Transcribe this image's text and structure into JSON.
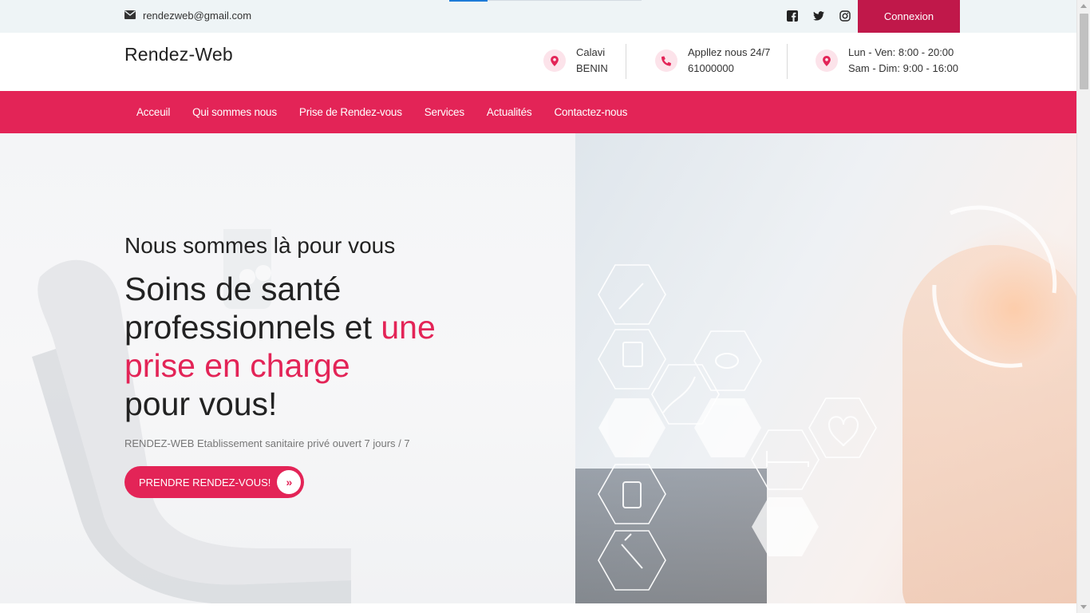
{
  "topbar": {
    "email": "rendezweb@gmail.com",
    "email_icon": "envelope-icon",
    "social_icons": [
      "facebook-icon",
      "twitter-icon",
      "instagram-icon"
    ],
    "login_label": "Connexion"
  },
  "header": {
    "brand": "Rendez-Web",
    "info": [
      {
        "icon": "map-marker-icon",
        "line1": "Calavi",
        "line2": "BENIN"
      },
      {
        "icon": "phone-icon",
        "line1": "Appllez nous 24/7",
        "line2": "61000000"
      },
      {
        "icon": "map-marker-icon",
        "line1": "Lun - Ven: 8:00 - 20:00",
        "line2": "Sam - Dim: 9:00 - 16:00"
      }
    ]
  },
  "nav": {
    "items": [
      "Acceuil",
      "Qui sommes nous",
      "Prise de Rendez-vous",
      "Services",
      "Actualités",
      "Contactez-nous"
    ]
  },
  "hero": {
    "kicker": "Nous sommes là pour vous",
    "headline_part1": "Soins de santé professionnels et ",
    "headline_highlight": "une prise en charge",
    "headline_part2": "pour vous!",
    "subtitle": "RENDEZ-WEB Etablissement sanitaire privé ouvert 7 jours / 7",
    "cta_label": "PRENDRE RENDEZ-VOUS!",
    "cta_icon": "double-chevron-right-icon",
    "image_icons": [
      "syringe-icon",
      "clipboard-icon",
      "dna-icon",
      "pills-icon",
      "heart-pulse-icon",
      "bed-icon",
      "medicine-bottle-icon",
      "dropper-icon"
    ]
  },
  "colors": {
    "accent": "#e32457",
    "login_bg": "#c0184a",
    "topbar_bg": "#eef4f6",
    "icon_circle": "#fce3ea"
  }
}
